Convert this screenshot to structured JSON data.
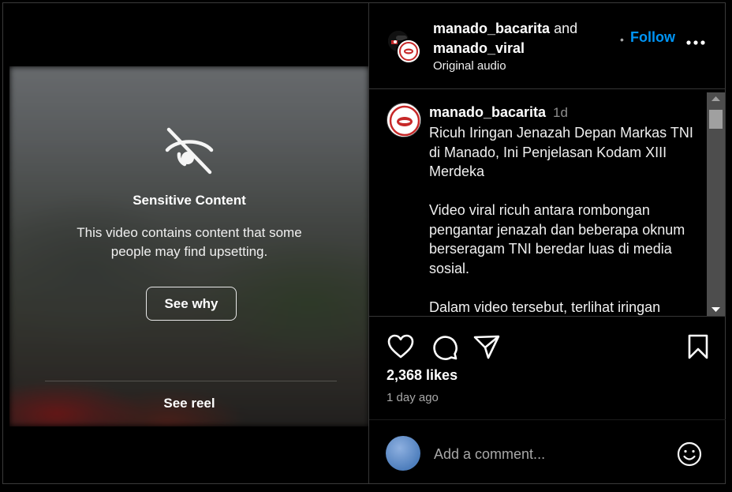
{
  "media": {
    "sensitive_title": "Sensitive Content",
    "sensitive_text": "This video contains content that some people may find upsetting.",
    "see_why_label": "See why",
    "see_reel_label": "See reel"
  },
  "header": {
    "user1": "manado_bacarita",
    "and": "and",
    "user2": "manado_viral",
    "audio": "Original audio",
    "dot": "•",
    "follow_label": "Follow",
    "more_icon": "more-horizontal-icon"
  },
  "caption": {
    "username": "manado_bacarita",
    "time": "1d",
    "text": "Ricuh Iringan Jenazah Depan Markas TNI di Manado, Ini Penjelasan Kodam XIII Merdeka\n\nVideo viral ricuh antara rombongan pengantar jenazah dan beberapa oknum berseragam TNI beredar luas di media sosial.\n\nDalam video tersebut, terlihat iringan"
  },
  "actions": {
    "icons": [
      "heart-icon",
      "comment-icon",
      "share-icon",
      "bookmark-icon"
    ],
    "likes": "2,368 likes",
    "time_ago": "1 day ago"
  },
  "comment": {
    "placeholder": "Add a comment...",
    "emoji_icon": "emoji-icon"
  },
  "colors": {
    "background": "#000000",
    "follow": "#0095f6",
    "muted": "#a8a8a8",
    "divider": "#363636"
  }
}
